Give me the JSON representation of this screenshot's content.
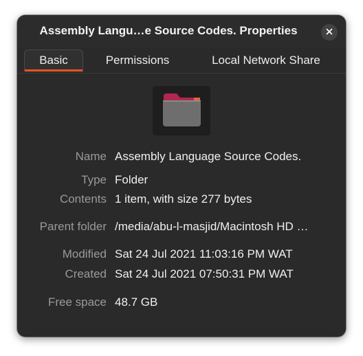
{
  "window": {
    "title": "Assembly Langu…e Source Codes. Properties"
  },
  "tabs": [
    {
      "label": "Basic",
      "active": true
    },
    {
      "label": "Permissions",
      "active": false
    },
    {
      "label": "Local Network Share",
      "active": false
    }
  ],
  "icons": {
    "close": "close-icon",
    "folder": "folder-icon"
  },
  "colors": {
    "accent": "#e95420",
    "folder_tab": "#b0284f",
    "folder_body": "#6e6e6e"
  },
  "properties": {
    "name": {
      "label": "Name",
      "value": "Assembly Language Source Codes."
    },
    "type": {
      "label": "Type",
      "value": "Folder"
    },
    "contents": {
      "label": "Contents",
      "value": "1 item, with size 277 bytes"
    },
    "parent_folder": {
      "label": "Parent folder",
      "value": "/media/abu-l-masjid/Macintosh HD …"
    },
    "modified": {
      "label": "Modified",
      "value": "Sat 24 Jul 2021 11:03:16 PM WAT"
    },
    "created": {
      "label": "Created",
      "value": "Sat 24 Jul 2021 07:50:31 PM WAT"
    },
    "free_space": {
      "label": "Free space",
      "value": "48.7 GB"
    }
  }
}
